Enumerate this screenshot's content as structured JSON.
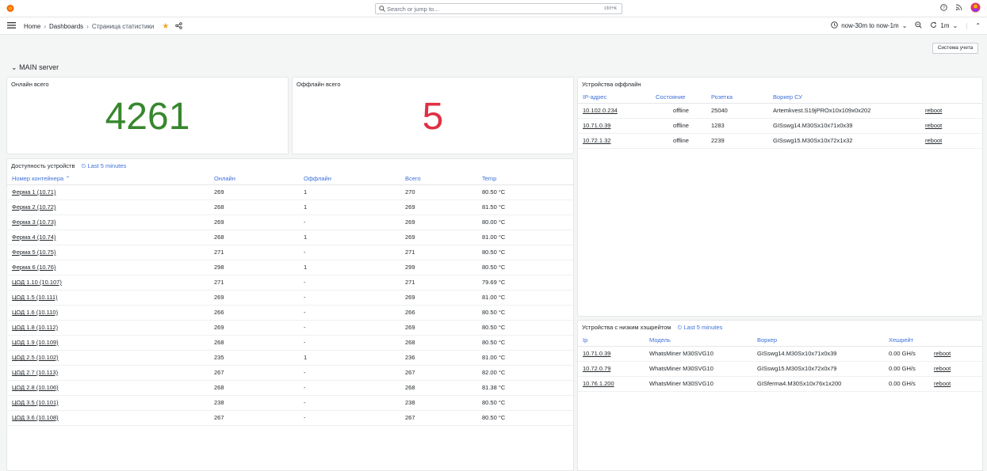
{
  "topbar": {
    "search_placeholder": "Search or jump to...",
    "search_shortcut": "ctrl+k"
  },
  "breadcrumb": {
    "home": "Home",
    "dashboards": "Dashboards",
    "current": "Страница статистики"
  },
  "timepicker": {
    "range": "now-30m to now-1m",
    "refresh_interval": "1m"
  },
  "system_button": "Система учета",
  "row": {
    "title": "MAIN server"
  },
  "online": {
    "title": "Онлайн всего",
    "value": "4261",
    "color": "#37872d"
  },
  "offline": {
    "title": "Оффлайн всего",
    "value": "5",
    "color": "#e02f44"
  },
  "availability": {
    "title": "Доступность устройств",
    "time_range": "Last 5 minutes",
    "headers": [
      "Номер контейнера",
      "Онлайн",
      "Оффлайн",
      "Всего",
      "Temp"
    ],
    "rows": [
      {
        "name": "Ферма 1 (10.71)",
        "online": "269",
        "offline": "1",
        "total": "270",
        "temp": "80.50 °C",
        "temp_color": "red"
      },
      {
        "name": "Ферма 2 (10.72)",
        "online": "268",
        "offline": "1",
        "total": "269",
        "temp": "81.50 °C",
        "temp_color": "red"
      },
      {
        "name": "Ферма 3 (10.73)",
        "online": "269",
        "offline": "-",
        "total": "269",
        "temp": "80.00 °C",
        "temp_color": "orange"
      },
      {
        "name": "Ферма 4 (10.74)",
        "online": "268",
        "offline": "1",
        "total": "269",
        "temp": "81.00 °C",
        "temp_color": "red"
      },
      {
        "name": "Ферма 5 (10.75)",
        "online": "271",
        "offline": "-",
        "total": "271",
        "temp": "80.50 °C",
        "temp_color": "red"
      },
      {
        "name": "Ферма 6 (10.76)",
        "online": "298",
        "offline": "1",
        "total": "299",
        "temp": "80.50 °C",
        "temp_color": "red"
      },
      {
        "name": "ЦОД 1.10 (10.107)",
        "online": "271",
        "offline": "-",
        "total": "271",
        "temp": "79.69 °C",
        "temp_color": "green"
      },
      {
        "name": "ЦОД 1.5 (10.111)",
        "online": "269",
        "offline": "-",
        "total": "269",
        "temp": "81.00 °C",
        "temp_color": "red"
      },
      {
        "name": "ЦОД 1.6 (10.110)",
        "online": "266",
        "offline": "-",
        "total": "266",
        "temp": "80.50 °C",
        "temp_color": "red"
      },
      {
        "name": "ЦОД 1.8 (10.112)",
        "online": "269",
        "offline": "-",
        "total": "269",
        "temp": "80.50 °C",
        "temp_color": "red"
      },
      {
        "name": "ЦОД 1.9 (10.109)",
        "online": "268",
        "offline": "-",
        "total": "268",
        "temp": "80.50 °C",
        "temp_color": "red"
      },
      {
        "name": "ЦОД 2.5 (10.102)",
        "online": "235",
        "offline": "1",
        "total": "236",
        "temp": "81.00 °C",
        "temp_color": "red"
      },
      {
        "name": "ЦОД 2.7 (10.113)",
        "online": "267",
        "offline": "-",
        "total": "267",
        "temp": "82.00 °C",
        "temp_color": "red"
      },
      {
        "name": "ЦОД 2.8 (10.106)",
        "online": "268",
        "offline": "-",
        "total": "268",
        "temp": "81.38 °C",
        "temp_color": "red"
      },
      {
        "name": "ЦОД 3.5 (10.101)",
        "online": "238",
        "offline": "-",
        "total": "238",
        "temp": "80.50 °C",
        "temp_color": "red"
      },
      {
        "name": "ЦОД 3.6 (10.108)",
        "online": "267",
        "offline": "-",
        "total": "267",
        "temp": "80.50 °C",
        "temp_color": "red"
      }
    ]
  },
  "offline_devices": {
    "title": "Устройства оффлайн",
    "headers": [
      "IP-адрес",
      "Состояние",
      "Розетка",
      "Воркер СУ",
      ""
    ],
    "rows": [
      {
        "ip": "10.102.0.234",
        "state": "offline",
        "socket": "25040",
        "worker": "Artemkvest.S19jPROx10x109x0x202",
        "action": "reboot"
      },
      {
        "ip": "10.71.0.39",
        "state": "offline",
        "socket": "1283",
        "worker": "GISswg14.M30Sx10x71x0x39",
        "action": "reboot"
      },
      {
        "ip": "10.72.1.32",
        "state": "offline",
        "socket": "2239",
        "worker": "GISswg15.M30Sx10x72x1x32",
        "action": "reboot"
      }
    ]
  },
  "low_hashrate": {
    "title": "Устройства с низким хэшрейтом",
    "time_range": "Last 5 minutes",
    "headers": [
      "Ip",
      "Модель",
      "Воркер",
      "Хешрейт",
      ""
    ],
    "rows": [
      {
        "ip": "10.71.0.39",
        "model": "WhatsMiner M30SVG10",
        "worker": "GISswg14.M30Sx10x71x0x39",
        "hashrate": "0.00 GH/s",
        "action": "reboot"
      },
      {
        "ip": "10.72.0.79",
        "model": "WhatsMiner M30SVG10",
        "worker": "GISswg15.M30Sx10x72x0x79",
        "hashrate": "0.00 GH/s",
        "action": "reboot"
      },
      {
        "ip": "10.76.1.200",
        "model": "WhatsMiner M30SVG10",
        "worker": "GISferma4.M30Sx10x76x1x200",
        "hashrate": "0.00 GH/s",
        "action": "reboot"
      }
    ]
  }
}
